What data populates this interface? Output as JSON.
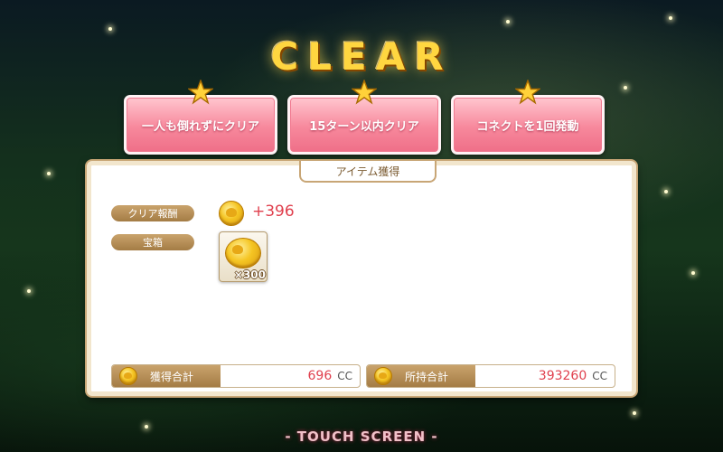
{
  "title": "CLEAR",
  "missions": [
    {
      "label": "一人も倒れずにクリア"
    },
    {
      "label": "15ターン以内クリア"
    },
    {
      "label": "コネクトを1回発動"
    }
  ],
  "panel": {
    "tab_label": "アイテム獲得",
    "clear_reward": {
      "label": "クリア報酬",
      "amount": "+396",
      "icon": "coin-icon"
    },
    "treasure": {
      "label": "宝箱",
      "item_count": "×300",
      "icon": "coin-icon"
    },
    "totals": [
      {
        "label": "獲得合計",
        "value": "696",
        "unit": "CC"
      },
      {
        "label": "所持合計",
        "value": "393260",
        "unit": "CC"
      }
    ]
  },
  "footer": {
    "touch_label": "- TOUCH SCREEN -"
  },
  "colors": {
    "accent_red": "#e0404e",
    "title_gold": "#ffd640",
    "mission_pink": "#f7889c"
  }
}
